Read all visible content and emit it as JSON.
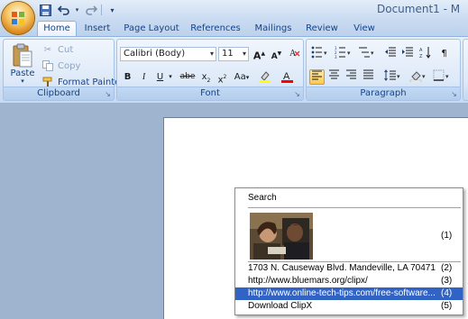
{
  "window": {
    "title": "Document1 - M"
  },
  "quick_access": {
    "save": "save-icon",
    "undo": "undo-icon",
    "redo": "redo-icon",
    "customize": "customize-arrow-icon"
  },
  "tabs": [
    {
      "label": "Home",
      "active": true
    },
    {
      "label": "Insert"
    },
    {
      "label": "Page Layout"
    },
    {
      "label": "References"
    },
    {
      "label": "Mailings"
    },
    {
      "label": "Review"
    },
    {
      "label": "View"
    }
  ],
  "clipboard": {
    "paste_label": "Paste",
    "cut_label": "Cut",
    "copy_label": "Copy",
    "format_painter_label": "Format Painter",
    "group_label": "Clipboard"
  },
  "font": {
    "font_name": "Calibri (Body)",
    "font_size": "11",
    "grow_label": "A",
    "shrink_label": "A",
    "bold": "B",
    "italic": "I",
    "underline": "U",
    "strikethrough": "abe",
    "subscript": "x",
    "superscript": "x",
    "change_case": "Aa",
    "highlight_color": "#ffff00",
    "font_color": "#ff0000",
    "group_label": "Font"
  },
  "paragraph": {
    "group_label": "Paragraph"
  },
  "menu": {
    "search_label": "Search",
    "items": [
      {
        "text": "1703 N. Causeway Blvd.  Mandeville, LA 70471",
        "key": "(2)"
      },
      {
        "text": "http://www.bluemars.org/clipx/",
        "key": "(3)"
      },
      {
        "text": "http://www.online-tech-tips.com/free-software...",
        "key": "(4)",
        "highlighted": true
      },
      {
        "text": "Download ClipX",
        "key": "(5)"
      }
    ],
    "image_key": "(1)"
  },
  "colors": {
    "accent": "#15428b",
    "menu_highlight": "#3163c5",
    "workspace": "#9fb4cf"
  }
}
